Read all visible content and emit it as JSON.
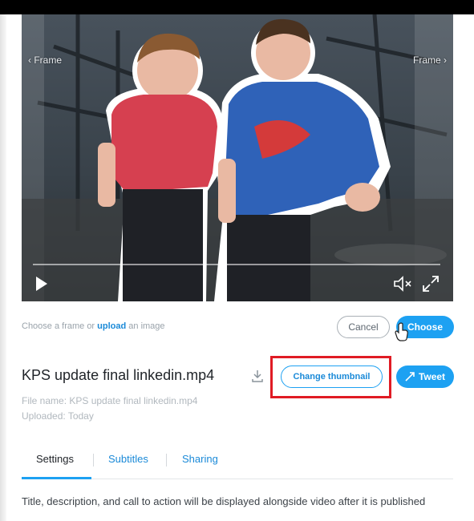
{
  "player": {
    "frame_prev": "‹ Frame",
    "frame_next": "Frame ›",
    "controls": {
      "play_icon": "play-icon",
      "mute_icon": "volume-muted-icon",
      "fullscreen_icon": "fullscreen-icon"
    }
  },
  "chooser": {
    "hint_prefix": "Choose a frame or ",
    "hint_link": "upload",
    "hint_suffix": " an image",
    "cancel_label": "Cancel",
    "choose_label": "Choose"
  },
  "video": {
    "title": "KPS update final linkedin.mp4",
    "change_thumbnail_label": "Change thumbnail",
    "tweet_label": "Tweet",
    "file_name": "File name: KPS update final linkedin.mp4",
    "uploaded": "Uploaded: Today"
  },
  "tabs": [
    {
      "label": "Settings",
      "active": true
    },
    {
      "label": "Subtitles",
      "active": false
    },
    {
      "label": "Sharing",
      "active": false
    }
  ],
  "description": "Title, description, and call to action will be displayed alongside video after it is published",
  "colors": {
    "accent": "#1da1f2",
    "highlight": "#e01b24",
    "link": "#1b8ad8"
  }
}
